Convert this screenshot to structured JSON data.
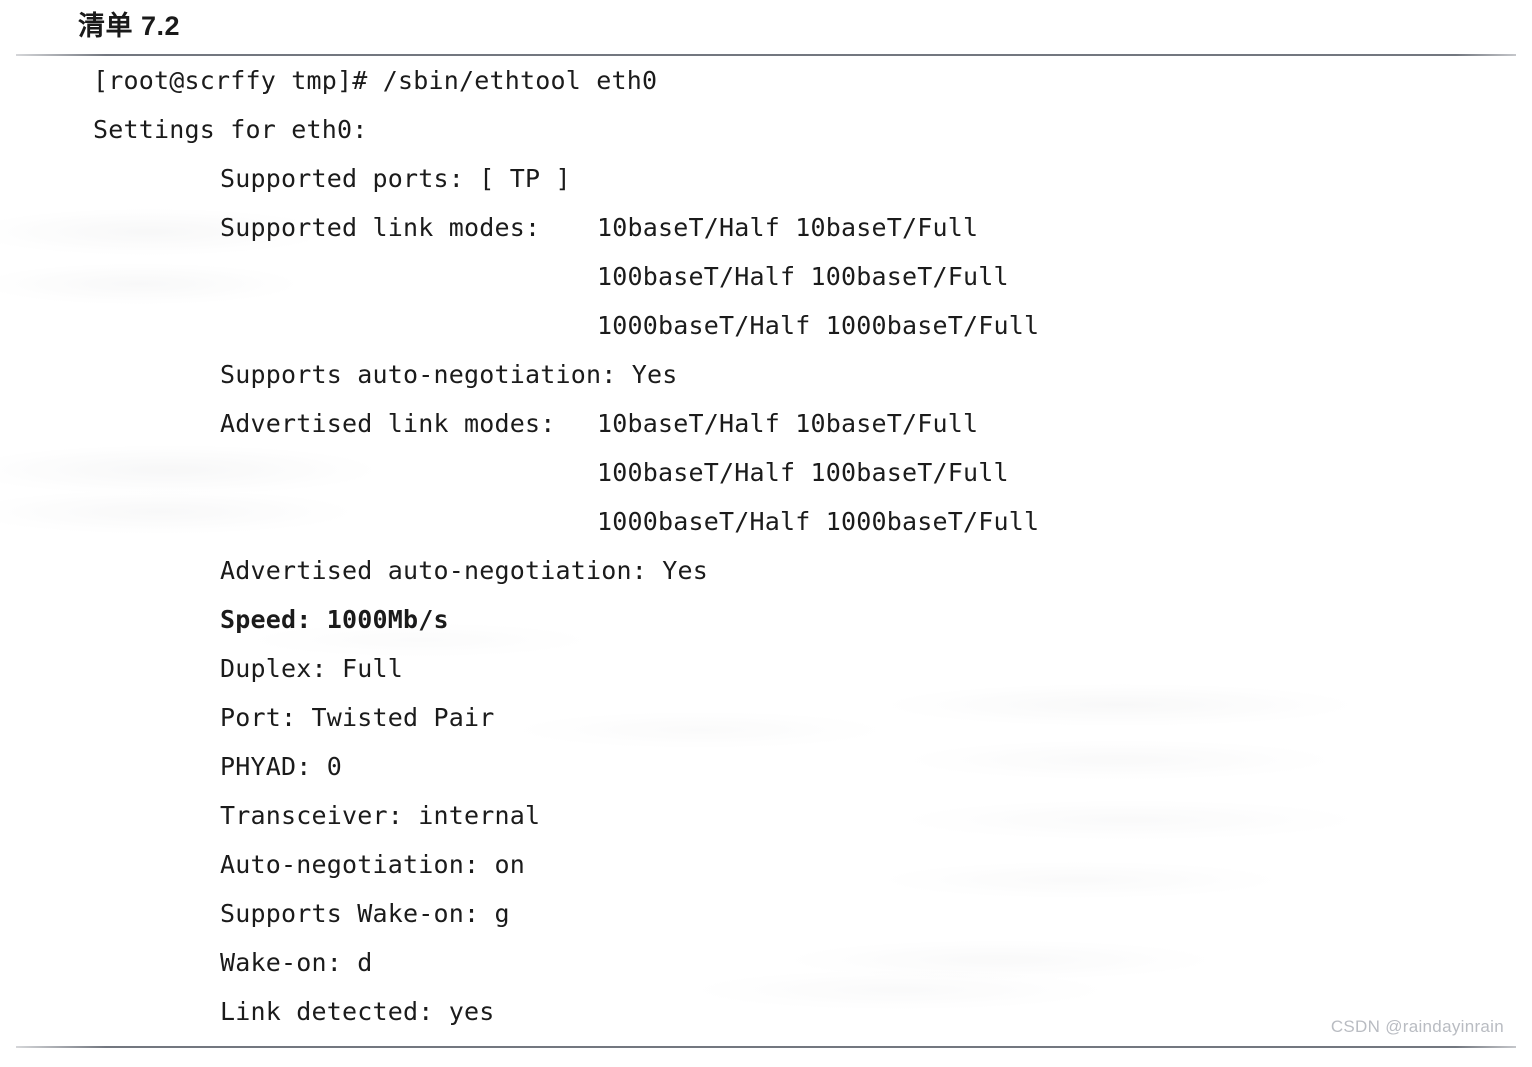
{
  "caption": {
    "label": "清单 7.2"
  },
  "terminal": {
    "lines": [
      {
        "indent": 0,
        "text": "[root@scrffy tmp]# /sbin/ethtool eth0",
        "bold": false
      },
      {
        "indent": 0,
        "text": "Settings for eth0:",
        "bold": false
      },
      {
        "indent": 1,
        "text": "Supported ports: [ TP ]",
        "bold": false
      },
      {
        "indent": 1,
        "text": "Supported link modes:",
        "bold": false,
        "value": "10baseT/Half 10baseT/Full"
      },
      {
        "indent": 2,
        "text": "100baseT/Half 100baseT/Full",
        "bold": false
      },
      {
        "indent": 2,
        "text": "1000baseT/Half 1000baseT/Full",
        "bold": false
      },
      {
        "indent": 1,
        "text": "Supports auto-negotiation: Yes",
        "bold": false
      },
      {
        "indent": 1,
        "text": "Advertised link modes:",
        "bold": false,
        "value": "10baseT/Half 10baseT/Full"
      },
      {
        "indent": 2,
        "text": "100baseT/Half 100baseT/Full",
        "bold": false
      },
      {
        "indent": 2,
        "text": "1000baseT/Half 1000baseT/Full",
        "bold": false
      },
      {
        "indent": 1,
        "text": "Advertised auto-negotiation: Yes",
        "bold": false
      },
      {
        "indent": 1,
        "text": "Speed: 1000Mb/s",
        "bold": true
      },
      {
        "indent": 1,
        "text": "Duplex: Full",
        "bold": false
      },
      {
        "indent": 1,
        "text": "Port: Twisted Pair",
        "bold": false
      },
      {
        "indent": 1,
        "text": "PHYAD: 0",
        "bold": false
      },
      {
        "indent": 1,
        "text": "Transceiver: internal",
        "bold": false
      },
      {
        "indent": 1,
        "text": "Auto-negotiation: on",
        "bold": false
      },
      {
        "indent": 1,
        "text": "Supports Wake-on: g",
        "bold": false
      },
      {
        "indent": 1,
        "text": "Wake-on: d",
        "bold": false
      },
      {
        "indent": 1,
        "text": "Link detected: yes",
        "bold": false
      }
    ]
  },
  "watermark": {
    "text": "CSDN @raindayinrain"
  }
}
